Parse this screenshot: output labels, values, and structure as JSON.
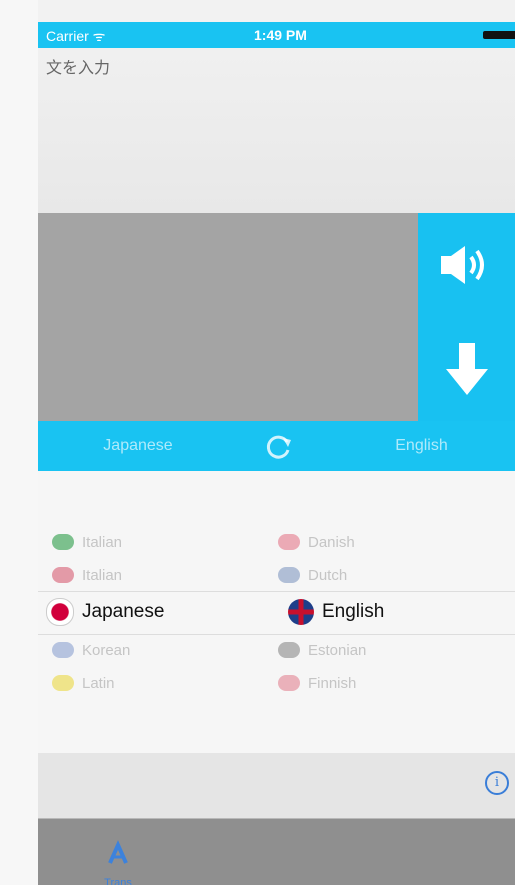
{
  "status_bar": {
    "carrier": "Carrier ᯤ",
    "time": "1:49 PM"
  },
  "input": {
    "placeholder": "文を入力"
  },
  "actions": {
    "speak_icon": "speaker-icon",
    "download_icon": "down-arrow-icon"
  },
  "lang_bar": {
    "source": "Japanese",
    "target": "English",
    "swap_icon": "refresh-icon"
  },
  "picker": {
    "left": [
      {
        "label": "Italian",
        "flag": "italy-flag-icon",
        "color": "#2c9b4a"
      },
      {
        "label": "Italian",
        "flag": "italy-flag-icon",
        "color": "#d33"
      },
      {
        "label": "Japanese",
        "flag": "japan-flag-icon",
        "color": "#d1003c"
      },
      {
        "label": "Korean",
        "flag": "korea-flag-icon",
        "color": "#3a5fb0"
      },
      {
        "label": "Latin",
        "flag": "latin-flag-icon",
        "color": "#e2c200"
      }
    ],
    "right": [
      {
        "label": "Danish",
        "flag": "denmark-flag-icon",
        "color": "#c8102e"
      },
      {
        "label": "Dutch",
        "flag": "netherlands-flag-icon",
        "color": "#1e4785"
      },
      {
        "label": "English",
        "flag": "uk-flag-icon",
        "color": "#c8102e"
      },
      {
        "label": "Estonian",
        "flag": "estonia-flag-icon",
        "color": "#555"
      },
      {
        "label": "Finnish",
        "flag": "finland-flag-icon",
        "color": "#d33"
      }
    ]
  },
  "tabs": {
    "first_label": "Trans"
  },
  "colors": {
    "accent": "#19c3f2",
    "link": "#3a7ed8"
  }
}
